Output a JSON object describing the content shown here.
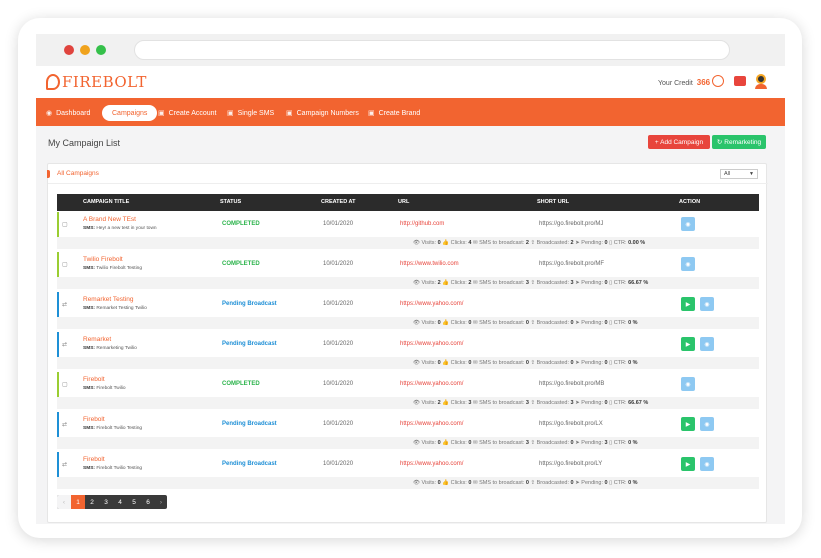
{
  "brand": {
    "name": "FIREBOLT",
    "accent": "#f26430"
  },
  "header": {
    "credit_label": "Your Credit",
    "credit_value": "366"
  },
  "nav": [
    {
      "label": "Dashboard",
      "icon": "dashboard-icon"
    },
    {
      "label": "Campaigns",
      "icon": ""
    },
    {
      "label": "Create Account",
      "icon": "chat-icon"
    },
    {
      "label": "Single SMS",
      "icon": "chat-icon"
    },
    {
      "label": "Campaign Numbers",
      "icon": "chat-icon"
    },
    {
      "label": "Create Brand",
      "icon": "chat-icon"
    }
  ],
  "page": {
    "title": "My Campaign List",
    "add_button": "+ Add Campaign",
    "remarket_button": "Remarketing"
  },
  "card": {
    "title": "All Campaigns",
    "filter_value": "All"
  },
  "table": {
    "headers": [
      "CAMPAIGN TITLE",
      "STATUS",
      "CREATED AT",
      "URL",
      "SHORT URL",
      "ACTION"
    ],
    "rows": [
      {
        "title": "A Brand New TEst",
        "sms": "Hey! a new test in your town",
        "status": "COMPLETED",
        "created": "10/01/2020",
        "url": "http://github.com",
        "short": "https://go.firebolt.pro/MJ",
        "stats": {
          "visits": "0",
          "clicks": "4",
          "sms_to_broadcast": "2",
          "broadcasted": "2",
          "pending": "0",
          "ctr": "0.00 %"
        }
      },
      {
        "title": "Twilio Firebolt",
        "sms": "Twilio Firebolt Testing",
        "status": "COMPLETED",
        "created": "10/01/2020",
        "url": "https://www.twilio.com",
        "short": "https://go.firebolt.pro/MF",
        "stats": {
          "visits": "2",
          "clicks": "2",
          "sms_to_broadcast": "3",
          "broadcasted": "3",
          "pending": "0",
          "ctr": "66.67 %"
        }
      },
      {
        "title": "Remarket Testing",
        "sms": "Remarket Testing Twilio",
        "status": "Pending Broadcast",
        "created": "10/01/2020",
        "url": "https://www.yahoo.com/",
        "short": "",
        "stats": {
          "visits": "0",
          "clicks": "0",
          "sms_to_broadcast": "0",
          "broadcasted": "0",
          "pending": "0",
          "ctr": "0 %"
        }
      },
      {
        "title": "Remarket",
        "sms": "Remarketing Twilio",
        "status": "Pending Broadcast",
        "created": "10/01/2020",
        "url": "https://www.yahoo.com/",
        "short": "",
        "stats": {
          "visits": "0",
          "clicks": "0",
          "sms_to_broadcast": "0",
          "broadcasted": "0",
          "pending": "0",
          "ctr": "0 %"
        }
      },
      {
        "title": "Firebolt",
        "sms": "Firebolt Twilio",
        "status": "COMPLETED",
        "created": "10/01/2020",
        "url": "https://www.yahoo.com/",
        "short": "https://go.firebolt.pro/MB",
        "stats": {
          "visits": "2",
          "clicks": "3",
          "sms_to_broadcast": "3",
          "broadcasted": "3",
          "pending": "0",
          "ctr": "66.67 %"
        }
      },
      {
        "title": "Firebolt",
        "sms": "Firebolt Twilio Testing",
        "status": "Pending Broadcast",
        "created": "10/01/2020",
        "url": "https://www.yahoo.com/",
        "short": "https://go.firebolt.pro/LX",
        "stats": {
          "visits": "0",
          "clicks": "0",
          "sms_to_broadcast": "3",
          "broadcasted": "0",
          "pending": "3",
          "ctr": "0 %"
        }
      },
      {
        "title": "Firebolt",
        "sms": "Firebolt Twilio Testing",
        "status": "Pending Broadcast",
        "created": "10/01/2020",
        "url": "https://www.yahoo.com/",
        "short": "https://go.firebolt.pro/LY",
        "stats": {
          "visits": "0",
          "clicks": "0",
          "sms_to_broadcast": "0",
          "broadcasted": "0",
          "pending": "0",
          "ctr": "0 %"
        }
      }
    ]
  },
  "stat_labels": {
    "visits": "Visits:",
    "clicks": "Clicks:",
    "sms_to_broadcast": "SMS to broadcast:",
    "broadcasted": "Broadcasted:",
    "pending": "Pending:",
    "ctr": "CTR:"
  },
  "sms_label": "SMS:",
  "pagination": {
    "prev": "‹",
    "pages": [
      "1",
      "2",
      "3",
      "4",
      "5",
      "6"
    ],
    "next": "›",
    "active": "1"
  }
}
